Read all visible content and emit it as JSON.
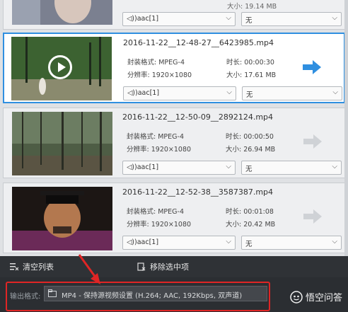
{
  "items": [
    {
      "filename": "",
      "audio": "◁))aac[1]",
      "subtitle": "无",
      "size_label": "大小:",
      "size_value": "19.14 MB",
      "selected": false
    },
    {
      "filename": "2016-11-22__12-48-27__6423985.mp4",
      "format_label": "封装格式:",
      "format_value": "MPEG-4",
      "res_label": "分辨率:",
      "res_value": "1920×1080",
      "dur_label": "时长:",
      "dur_value": "00:00:30",
      "size_label": "大小:",
      "size_value": "17.61 MB",
      "audio": "◁))aac[1]",
      "subtitle": "无",
      "selected": true
    },
    {
      "filename": "2016-11-22__12-50-09__2892124.mp4",
      "format_label": "封装格式:",
      "format_value": "MPEG-4",
      "res_label": "分辨率:",
      "res_value": "1920×1080",
      "dur_label": "时长:",
      "dur_value": "00:00:50",
      "size_label": "大小:",
      "size_value": "26.94 MB",
      "audio": "◁))aac[1]",
      "subtitle": "无",
      "selected": false
    },
    {
      "filename": "2016-11-22__12-52-38__3587387.mp4",
      "format_label": "封装格式:",
      "format_value": "MPEG-4",
      "res_label": "分辨率:",
      "res_value": "1920×1080",
      "dur_label": "时长:",
      "dur_value": "00:01:08",
      "size_label": "大小:",
      "size_value": "20.42 MB",
      "audio": "◁))aac[1]",
      "subtitle": "无",
      "selected": false
    }
  ],
  "toolbar": {
    "clear_label": "清空列表",
    "remove_label": "移除选中项"
  },
  "output": {
    "label": "输出格式:",
    "value": "MP4 - 保持源视频设置 (H.264; AAC, 192Kbps, 双声道)"
  },
  "watermark": "悟空问答",
  "colors": {
    "accent": "#2f8fe0",
    "highlight_box": "#e02525"
  }
}
